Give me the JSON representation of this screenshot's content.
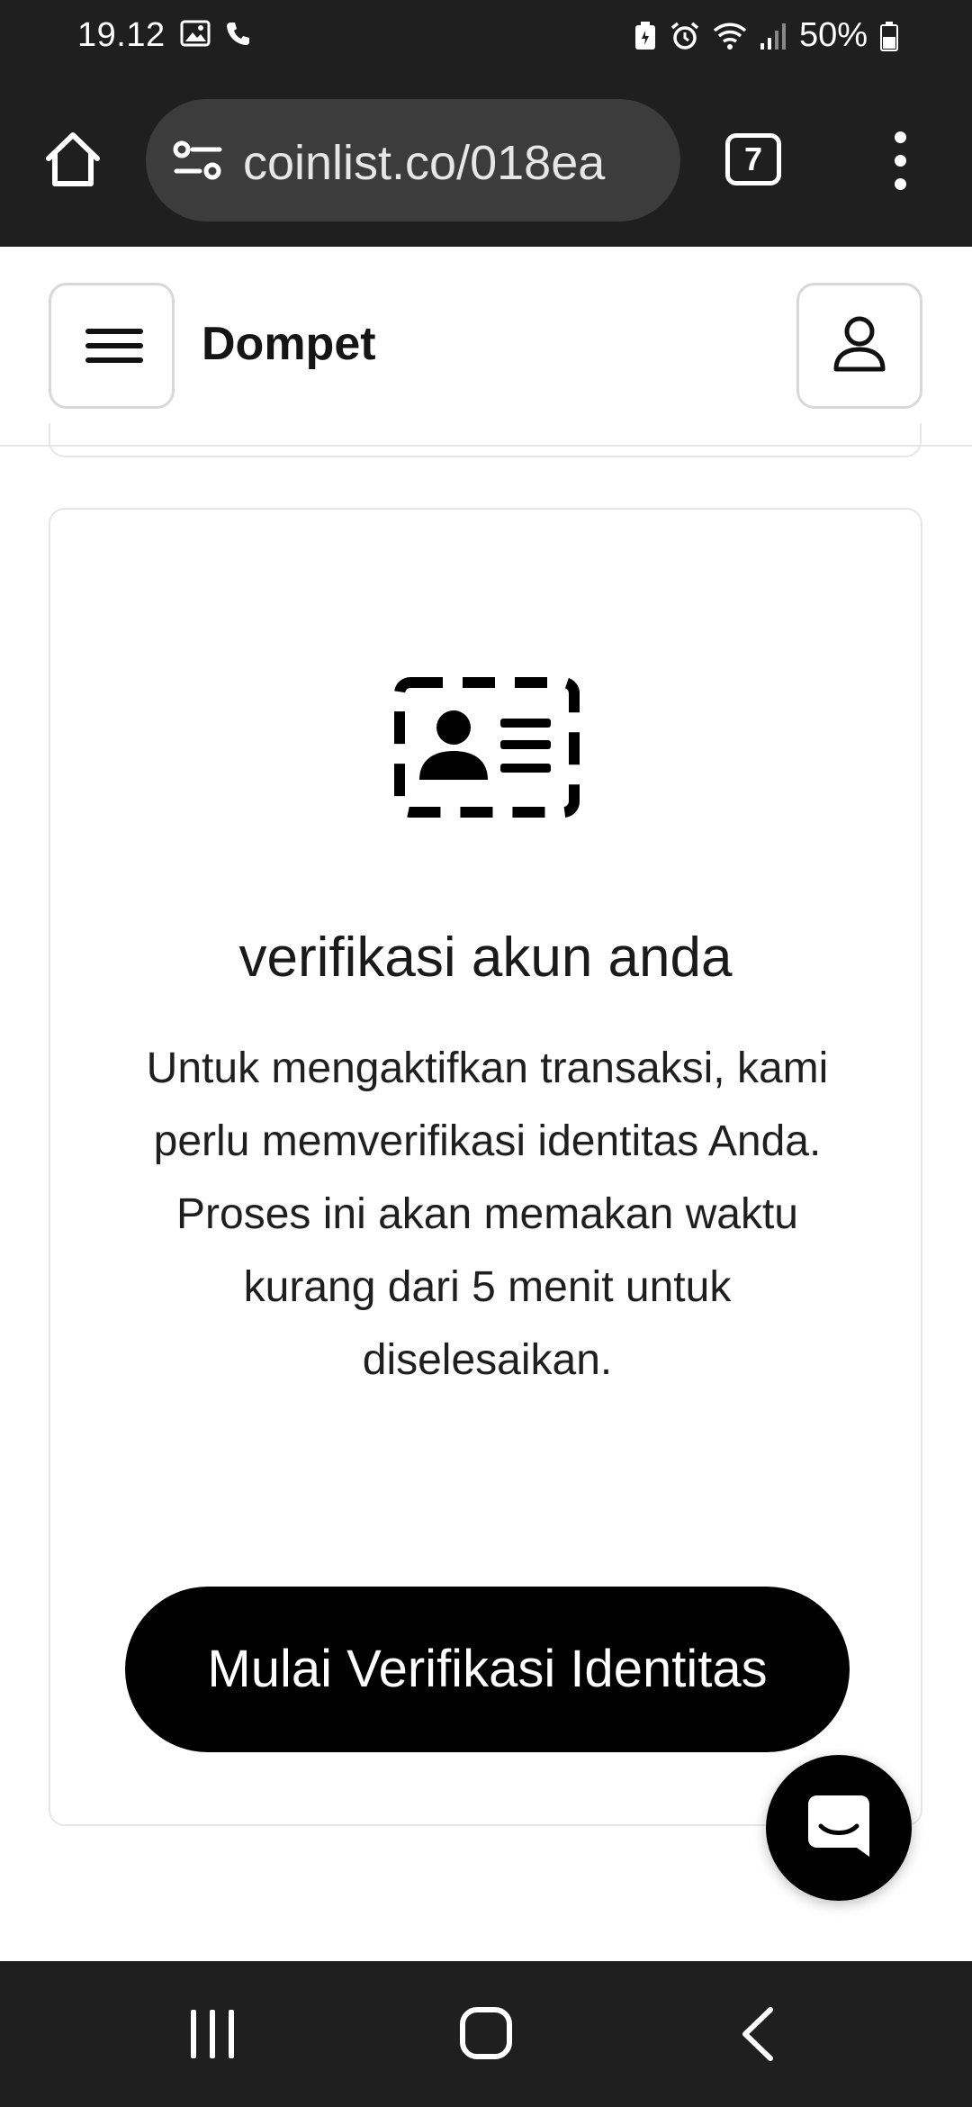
{
  "status_bar": {
    "time": "19.12",
    "battery": "50%",
    "icons": [
      "image-icon",
      "phone-icon",
      "battery-saver-icon",
      "alarm-icon",
      "wifi-icon",
      "signal-icon",
      "battery-icon"
    ]
  },
  "browser": {
    "url": "coinlist.co/018ea",
    "tab_count": "7"
  },
  "header": {
    "title": "Dompet"
  },
  "verification_card": {
    "title": "verifikasi akun anda",
    "description": "Untuk mengaktifkan transaksi, kami perlu memverifikasi identitas Anda. Proses ini akan memakan waktu kurang dari 5 menit untuk diselesaikan.",
    "button_label": "Mulai Verifikasi Identitas"
  },
  "colors": {
    "system_bar": "#1f1f1f",
    "url_box": "#3c3c3c",
    "button": "#000000",
    "card_border": "#e6e6e6"
  }
}
